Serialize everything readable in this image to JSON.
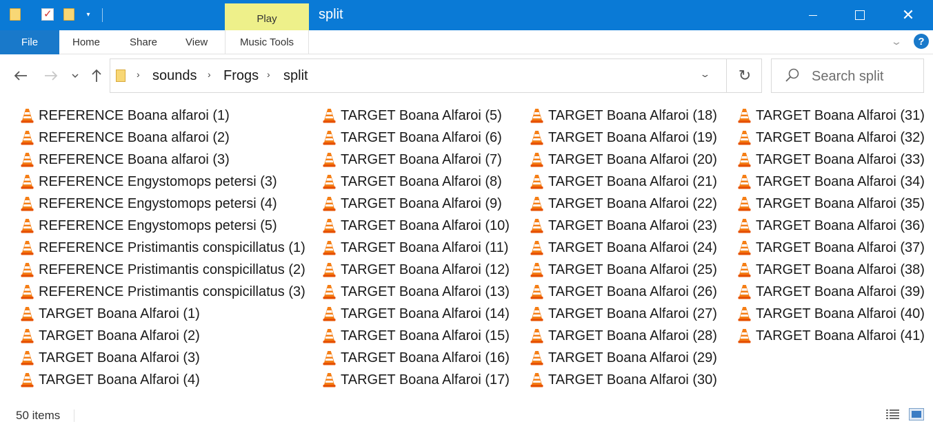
{
  "titlebar": {
    "title": "split",
    "context_tab": "Play",
    "accent_color": "#0a7ad6"
  },
  "ribbon": {
    "tabs": [
      "File",
      "Home",
      "Share",
      "View",
      "Music Tools"
    ]
  },
  "navigation": {
    "breadcrumbs": [
      "sounds",
      "Frogs",
      "split"
    ]
  },
  "search": {
    "placeholder": "Search split"
  },
  "files": {
    "icon": "vlc-cone-icon",
    "columns": [
      [
        "REFERENCE Boana alfaroi (1)",
        "REFERENCE Boana alfaroi (2)",
        "REFERENCE Boana alfaroi (3)",
        "REFERENCE Engystomops petersi (3)",
        "REFERENCE Engystomops petersi (4)",
        "REFERENCE Engystomops petersi (5)",
        "REFERENCE Pristimantis conspicillatus (1)",
        "REFERENCE Pristimantis conspicillatus (2)",
        "REFERENCE Pristimantis conspicillatus (3)",
        "TARGET Boana Alfaroi (1)",
        "TARGET Boana Alfaroi (2)",
        "TARGET Boana Alfaroi (3)",
        "TARGET Boana Alfaroi (4)"
      ],
      [
        "TARGET Boana Alfaroi (5)",
        "TARGET Boana Alfaroi (6)",
        "TARGET Boana Alfaroi (7)",
        "TARGET Boana Alfaroi (8)",
        "TARGET Boana Alfaroi (9)",
        "TARGET Boana Alfaroi (10)",
        "TARGET Boana Alfaroi (11)",
        "TARGET Boana Alfaroi (12)",
        "TARGET Boana Alfaroi (13)",
        "TARGET Boana Alfaroi (14)",
        "TARGET Boana Alfaroi (15)",
        "TARGET Boana Alfaroi (16)",
        "TARGET Boana Alfaroi (17)"
      ],
      [
        "TARGET Boana Alfaroi (18)",
        "TARGET Boana Alfaroi (19)",
        "TARGET Boana Alfaroi (20)",
        "TARGET Boana Alfaroi (21)",
        "TARGET Boana Alfaroi (22)",
        "TARGET Boana Alfaroi (23)",
        "TARGET Boana Alfaroi (24)",
        "TARGET Boana Alfaroi (25)",
        "TARGET Boana Alfaroi (26)",
        "TARGET Boana Alfaroi (27)",
        "TARGET Boana Alfaroi (28)",
        "TARGET Boana Alfaroi (29)",
        "TARGET Boana Alfaroi (30)"
      ],
      [
        "TARGET Boana Alfaroi (31)",
        "TARGET Boana Alfaroi (32)",
        "TARGET Boana Alfaroi (33)",
        "TARGET Boana Alfaroi (34)",
        "TARGET Boana Alfaroi (35)",
        "TARGET Boana Alfaroi (36)",
        "TARGET Boana Alfaroi (37)",
        "TARGET Boana Alfaroi (38)",
        "TARGET Boana Alfaroi (39)",
        "TARGET Boana Alfaroi (40)",
        "TARGET Boana Alfaroi (41)"
      ]
    ]
  },
  "status": {
    "item_count": "50 items"
  }
}
